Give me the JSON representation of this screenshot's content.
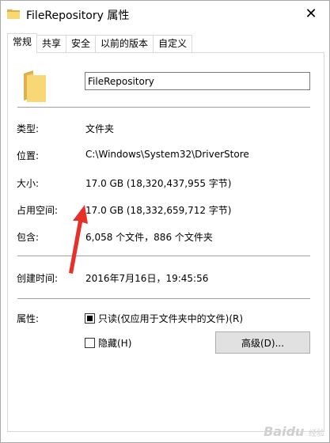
{
  "window": {
    "title": "FileRepository 属性",
    "close_glyph": "✕"
  },
  "tabs": [
    {
      "label": "常规",
      "active": true
    },
    {
      "label": "共享",
      "active": false
    },
    {
      "label": "安全",
      "active": false
    },
    {
      "label": "以前的版本",
      "active": false
    },
    {
      "label": "自定义",
      "active": false
    }
  ],
  "general": {
    "name_value": "FileRepository",
    "type": {
      "label": "类型:",
      "value": "文件夹"
    },
    "location": {
      "label": "位置:",
      "value": "C:\\Windows\\System32\\DriverStore"
    },
    "size": {
      "label": "大小:",
      "value": "17.0 GB (18,320,437,955 字节)"
    },
    "size_on_disk": {
      "label": "占用空间:",
      "value": "17.0 GB (18,332,659,712 字节)"
    },
    "contains": {
      "label": "包含:",
      "value": "6,058 个文件，886 个文件夹"
    },
    "created": {
      "label": "创建时间:",
      "value": "2016年7月16日，19:45:56"
    },
    "attributes": {
      "label": "属性:",
      "readonly": {
        "label": "只读(仅应用于文件夹中的文件)(R)",
        "state": "indeterminate"
      },
      "hidden": {
        "label": "隐藏(H)",
        "state": "unchecked"
      },
      "advanced_button": "高级(D)..."
    }
  },
  "colors": {
    "folder_yellow": "#f8d775",
    "annotation_arrow": "#e8302a"
  },
  "watermark": {
    "brand": "Baidu",
    "sub": "经验"
  }
}
